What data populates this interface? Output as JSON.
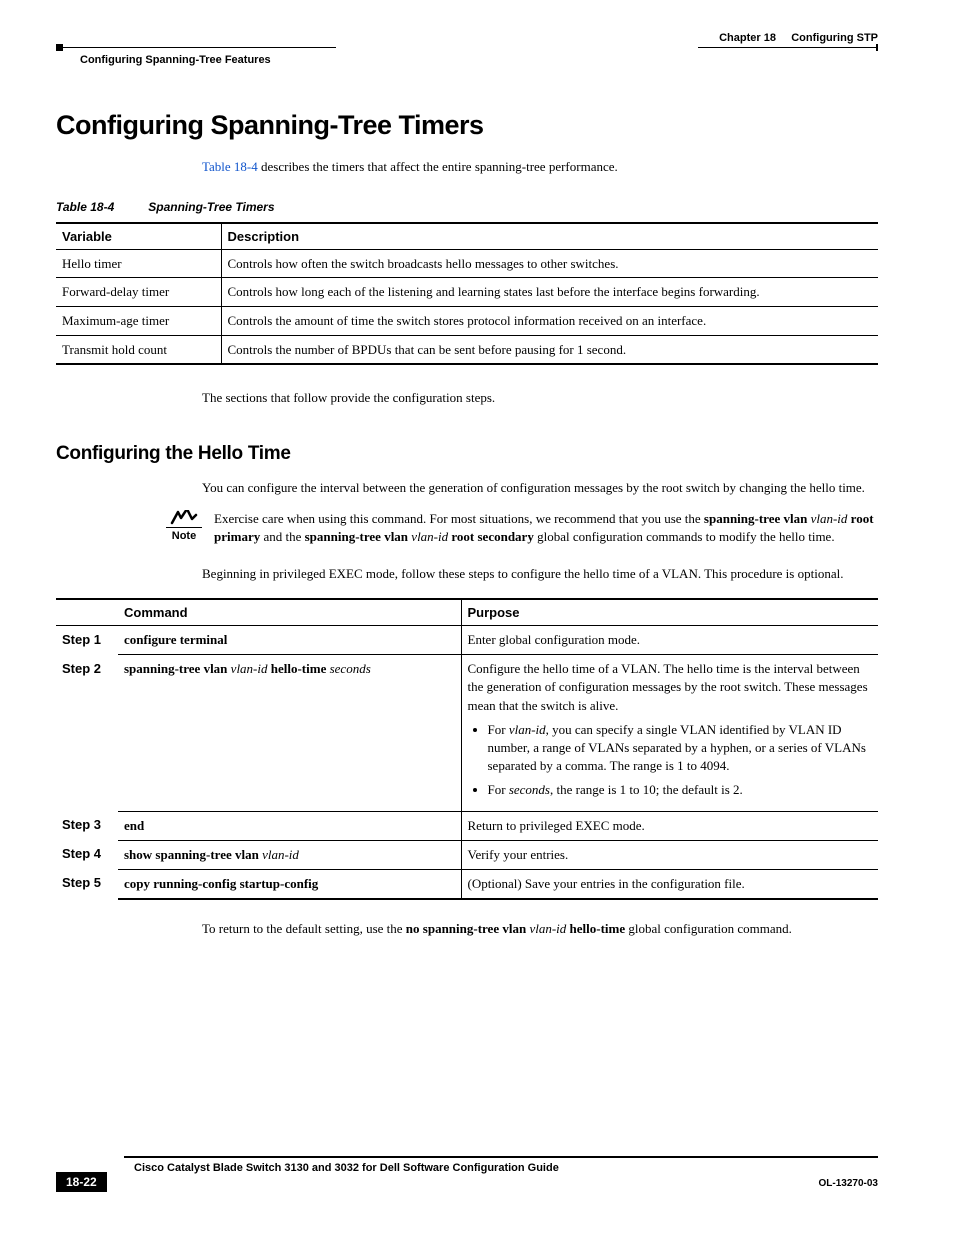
{
  "header": {
    "chapter_label": "Chapter 18",
    "chapter_title": "Configuring STP",
    "section_header": "Configuring Spanning-Tree Features"
  },
  "h1": "Configuring Spanning-Tree Timers",
  "intro": {
    "link": "Table 18-4",
    "rest": " describes the timers that affect the entire spanning-tree performance."
  },
  "table_caption": {
    "num": "Table 18-4",
    "title": "Spanning-Tree Timers"
  },
  "timers": {
    "headers": {
      "var": "Variable",
      "desc": "Description"
    },
    "rows": [
      {
        "var": "Hello timer",
        "desc": "Controls how often the switch broadcasts hello messages to other switches."
      },
      {
        "var": "Forward-delay timer",
        "desc": "Controls how long each of the listening and learning states last before the interface begins forwarding."
      },
      {
        "var": "Maximum-age timer",
        "desc": "Controls the amount of time the switch stores protocol information received on an interface."
      },
      {
        "var": "Transmit hold count",
        "desc": "Controls the number of BPDUs that can be sent before pausing for 1 second."
      }
    ]
  },
  "after_table": "The sections that follow provide the configuration steps.",
  "h2": "Configuring the Hello Time",
  "p1": "You can configure the interval between the generation of configuration messages by the root switch by changing the hello time.",
  "note": {
    "label": "Note",
    "t1": "Exercise care when using this command. For most situations, we recommend that you use the ",
    "b1": "spanning-tree vlan",
    "i1": " vlan-id ",
    "b2": "root primary",
    "t2": " and the ",
    "b3": "spanning-tree vlan",
    "i2": " vlan-id ",
    "b4": "root secondary",
    "t3": " global configuration commands to modify the hello time."
  },
  "p2": "Beginning in privileged EXEC mode, follow these steps to configure the hello time of a VLAN. This procedure is optional.",
  "steps": {
    "headers": {
      "cmd": "Command",
      "purp": "Purpose"
    },
    "rows": [
      {
        "step": "Step 1",
        "cmd": {
          "b1": "configure terminal"
        },
        "purp": {
          "p1": "Enter global configuration mode."
        }
      },
      {
        "step": "Step 2",
        "cmd": {
          "b1": "spanning-tree vlan",
          "i1": " vlan-id ",
          "b2": "hello-time",
          "i2": " seconds"
        },
        "purp": {
          "p1": "Configure the hello time of a VLAN. The hello time is the interval between the generation of configuration messages by the root switch. These messages mean that the switch is alive.",
          "li1a": "For ",
          "li1i": "vlan-id",
          "li1b": ", you can specify a single VLAN identified by VLAN ID number, a range of VLANs separated by a hyphen, or a series of VLANs separated by a comma. The range is 1 to 4094.",
          "li2a": "For ",
          "li2i": "seconds",
          "li2b": ", the range is 1 to 10; the default is 2."
        }
      },
      {
        "step": "Step 3",
        "cmd": {
          "b1": "end"
        },
        "purp": {
          "p1": "Return to privileged EXEC mode."
        }
      },
      {
        "step": "Step 4",
        "cmd": {
          "b1": "show spanning-tree vlan",
          "i1": " vlan-id"
        },
        "purp": {
          "p1": "Verify your entries."
        }
      },
      {
        "step": "Step 5",
        "cmd": {
          "b1": "copy running-config startup-config"
        },
        "purp": {
          "p1": "(Optional) Save your entries in the configuration file."
        }
      }
    ]
  },
  "p3": {
    "t1": "To return to the default setting, use the ",
    "b1": "no spanning-tree vlan",
    "i1": " vlan-id ",
    "b2": "hello-time",
    "t2": " global configuration command."
  },
  "footer": {
    "title": "Cisco Catalyst Blade Switch 3130 and 3032 for Dell Software Configuration Guide",
    "page": "18-22",
    "docid": "OL-13270-03"
  }
}
